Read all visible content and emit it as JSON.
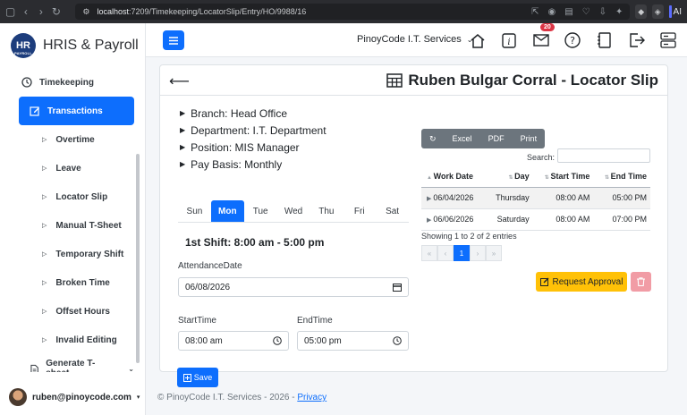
{
  "browser": {
    "url_host": "localhost",
    "url_path": ":7209/Timekeeping/LocatorSlip/Entry/HO/9988/16",
    "ai_label": "AI"
  },
  "sidebar": {
    "brand_logo_text": "HR",
    "brand_logo_sub": "PAYROLL",
    "brand_name": "HRIS & Payroll",
    "section": "Timekeeping",
    "active_item": "Transactions",
    "items": [
      "Overtime",
      "Leave",
      "Locator Slip",
      "Manual T-Sheet",
      "Temporary Shift",
      "Broken Time",
      "Offset Hours",
      "Invalid Editing"
    ],
    "bottom_item": "Generate T-sheet",
    "user": "ruben@pinoycode.com"
  },
  "topbar": {
    "company": "PinoyCode I.T. Services",
    "mail_badge": "20"
  },
  "page": {
    "title": "Ruben Bulgar Corral - Locator Slip",
    "info": [
      "Branch: Head Office",
      "Department: I.T. Department",
      "Position: MIS Manager",
      "Pay Basis: Monthly"
    ],
    "days": [
      "Sun",
      "Mon",
      "Tue",
      "Wed",
      "Thu",
      "Fri",
      "Sat"
    ],
    "active_day": "Mon",
    "shift": "1st Shift: 8:00 am - 5:00 pm",
    "attendance_date_label": "AttendanceDate",
    "attendance_date_value": "06/08/2026",
    "start_time_label": "StartTime",
    "start_time_value": "08:00 am",
    "end_time_label": "EndTime",
    "end_time_value": "05:00 pm",
    "save_label": "Save"
  },
  "table": {
    "buttons": [
      "Excel",
      "PDF",
      "Print"
    ],
    "search_label": "Search:",
    "headers": [
      "Work Date",
      "Day",
      "Start Time",
      "End Time"
    ],
    "rows": [
      [
        "06/04/2026",
        "Thursday",
        "08:00 AM",
        "05:00 PM"
      ],
      [
        "06/06/2026",
        "Saturday",
        "08:00 AM",
        "07:00 PM"
      ]
    ],
    "showing": "Showing 1 to 2 of 2 entries",
    "pages": [
      "«",
      "‹",
      "1",
      "›",
      "»"
    ],
    "request_label": "Request Approval"
  },
  "footer": {
    "text": "© PinoyCode I.T. Services - 2026 - ",
    "link": "Privacy"
  },
  "colors": {
    "primary": "#0d6efd",
    "warning": "#ffc107",
    "danger_light": "#f19ca5",
    "badge": "#dc3545"
  }
}
